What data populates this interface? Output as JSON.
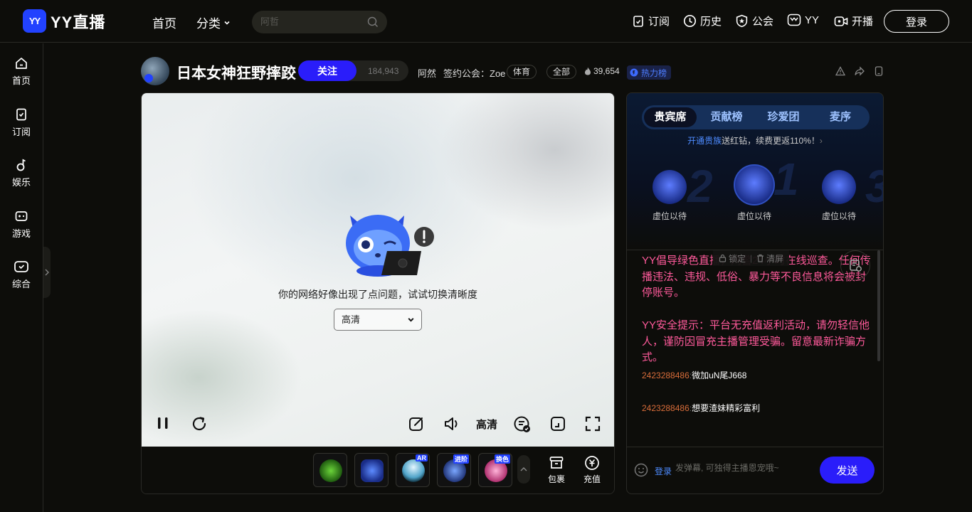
{
  "brand": {
    "logo_mark": "YY",
    "logo_text": "YY直播"
  },
  "topnav": {
    "home": "首页",
    "category": "分类",
    "search_placeholder": "阿哲",
    "subscribe": "订阅",
    "history": "历史",
    "guild": "公会",
    "yy": "YY",
    "start_live": "开播",
    "login": "登录"
  },
  "sidebar": {
    "items": [
      {
        "label": "首页",
        "icon": "home-icon"
      },
      {
        "label": "订阅",
        "icon": "bookmark-icon"
      },
      {
        "label": "娱乐",
        "icon": "music-icon"
      },
      {
        "label": "游戏",
        "icon": "gamepad-icon"
      },
      {
        "label": "综合",
        "icon": "tv-icon"
      }
    ]
  },
  "room": {
    "title": "日本女神狂野摔跤",
    "follow_label": "关注",
    "follow_count": "184,943",
    "host": "阿然",
    "guild": "签约公会：Zoe",
    "tag_sports": "体育",
    "tag_all": "全部",
    "heat": "39,654",
    "heat_rank": "热力榜"
  },
  "player": {
    "error_text": "你的网络好像出现了点问题，试试切换清晰度",
    "quality_selected": "高清",
    "quality_label": "高清"
  },
  "gifts": {
    "items": [
      {
        "name": "green-gift",
        "tag": ""
      },
      {
        "name": "glove-gift",
        "tag": ""
      },
      {
        "name": "ghost-gift",
        "tag": "AR"
      },
      {
        "name": "robot-gift",
        "tag": "进阶"
      },
      {
        "name": "candy-gift",
        "tag": "换色"
      }
    ],
    "package": "包裹",
    "recharge": "充值"
  },
  "panel": {
    "tabs": [
      "贵宾席",
      "贡献榜",
      "珍爱团",
      "麦序"
    ],
    "vip_link": "开通贵族",
    "vip_text": "送红钻，续费更返110%！",
    "seats": [
      {
        "label": "虚位以待",
        "rank": "2"
      },
      {
        "label": "虚位以待",
        "rank": "1"
      },
      {
        "label": "虚位以待",
        "rank": "3"
      }
    ],
    "lock": "锁定",
    "clear": "清屏",
    "notice1": "YY倡导绿色直播，网警24小时在线巡查。任何传播违法、违规、低俗、暴力等不良信息将会被封停账号。",
    "notice2": "YY安全提示：平台无充值返利活动，请勿轻信他人，谨防因冒充主播管理受骗。留意最新诈骗方式。",
    "messages": [
      {
        "uid": "2423288486",
        "text": "微加uN尾J668"
      },
      {
        "uid": "2423288486",
        "text": "想要渣妹精彩富利"
      }
    ],
    "input_login": "登录",
    "input_placeholder": "发弹幕, 可独得主播恩宠哦~",
    "send": "发送"
  },
  "colors": {
    "accent": "#2a1dfa",
    "notice": "#ff5a9b",
    "uid": "#d96d3a",
    "link": "#4d8bff"
  }
}
